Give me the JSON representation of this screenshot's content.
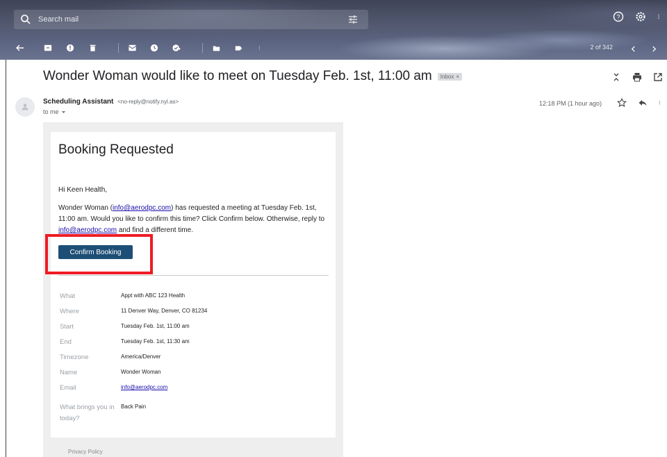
{
  "search": {
    "placeholder": "Search mail"
  },
  "toolbar": {
    "pager": "2 of 342"
  },
  "message": {
    "subject": "Wonder Woman would like to meet on Tuesday Feb. 1st, 11:00 am",
    "label_chip": "Inbox",
    "sender_name": "Scheduling Assistant",
    "sender_email": "<no-reply@notify.nyl.as>",
    "recipient": "to me",
    "time": "12:18 PM (1 hour ago)"
  },
  "email": {
    "title": "Booking Requested",
    "greeting": "Hi Keen Health,",
    "body_1": "Wonder Woman (",
    "body_link_1": "info@aerodpc.com",
    "body_2": ") has requested a meeting at Tuesday Feb. 1st, 11:00 am. Would you like to confirm this time? Click Confirm below. Otherwise, reply to ",
    "body_link_2": "info@aerodpc.com",
    "body_3": " and find a different time.",
    "confirm_label": "Confirm Booking",
    "details": [
      {
        "label": "What",
        "value": "Appt with ABC 123 Health"
      },
      {
        "label": "Where",
        "value": "11 Denver Way, Denver, CO 81234"
      },
      {
        "label": "Start",
        "value": "Tuesday Feb. 1st, 11:00 am"
      },
      {
        "label": "End",
        "value": "Tuesday Feb. 1st, 11:30 am"
      },
      {
        "label": "Timezone",
        "value": "America/Denver"
      },
      {
        "label": "Name",
        "value": "Wonder Woman"
      },
      {
        "label": "Email",
        "value": "info@aerodpc.com"
      },
      {
        "label": "What brings you in today?",
        "value": "Back Pain"
      }
    ],
    "privacy": "Privacy Policy"
  },
  "colors": {
    "confirm_button": "#1d4f76",
    "highlight": "#ee1c25",
    "link": "#1a0dab"
  }
}
